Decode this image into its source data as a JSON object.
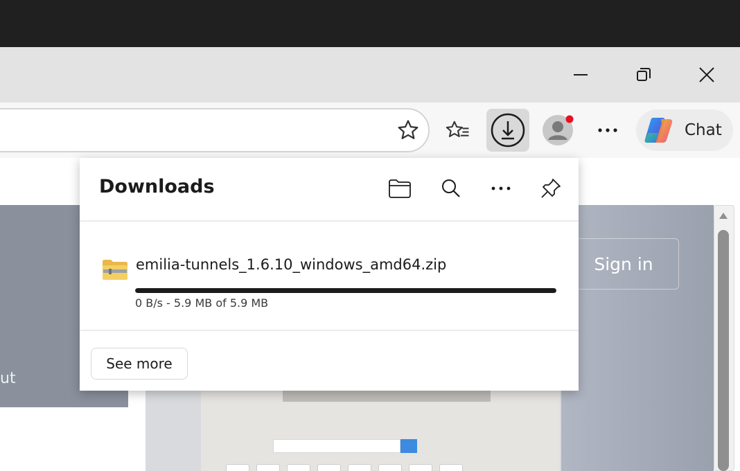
{
  "window": {
    "controls": [
      "minimize-icon",
      "restore-icon",
      "close-icon"
    ]
  },
  "toolbar": {
    "chat_label": "Chat",
    "icons": [
      "star-icon",
      "favorites-icon",
      "download-icon",
      "profile-icon",
      "more-icon",
      "copilot-icon"
    ],
    "profile_notification_color": "#e81123"
  },
  "page": {
    "sign_in_label": "Sign in",
    "left_text": "ut"
  },
  "downloads": {
    "title": "Downloads",
    "header_icons": [
      "folder-icon",
      "search-icon",
      "more-icon",
      "pin-icon"
    ],
    "items": [
      {
        "filename": "emilia-tunnels_1.6.10_windows_amd64.zip",
        "status": "0 B/s - 5.9 MB of 5.9 MB",
        "progress_percent": 100,
        "icon": "zip-folder-icon"
      }
    ],
    "see_more_label": "See more"
  },
  "colors": {
    "progress": "#1b1b1b",
    "accent": "#3c8be0"
  }
}
